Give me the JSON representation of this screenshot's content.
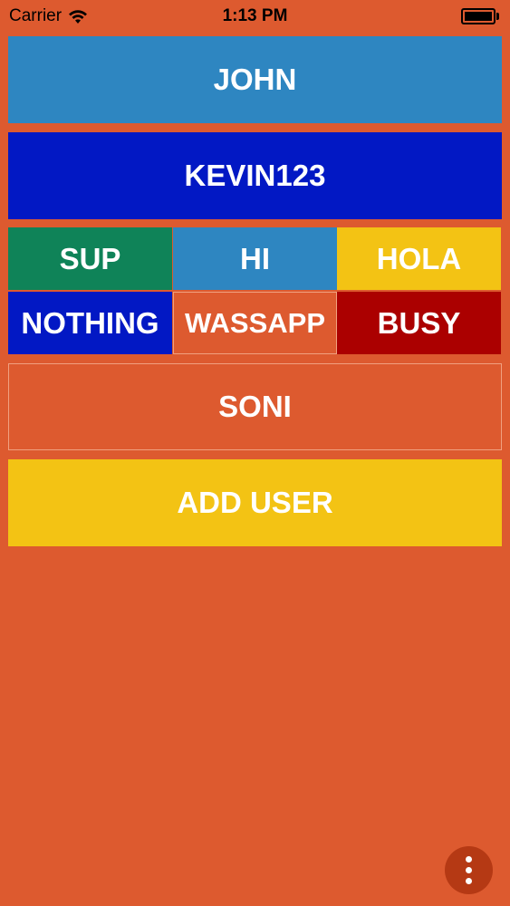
{
  "status_bar": {
    "carrier": "Carrier",
    "time": "1:13 PM",
    "icons": [
      "wifi-icon",
      "battery-icon"
    ]
  },
  "users": {
    "first": "JOHN",
    "second": "KEVIN123",
    "third": "SONI"
  },
  "messages": {
    "row1": [
      "SUP",
      "HI",
      "HOLA"
    ],
    "row2": [
      "NOTHING",
      "WASSAPP",
      "BUSY"
    ]
  },
  "actions": {
    "add_user": "ADD USER",
    "overflow_icon": "more-vertical-icon"
  },
  "colors": {
    "background": "#dd5a2f",
    "blue": "#2e86c1",
    "dark_blue": "#0218c4",
    "green": "#0f8358",
    "yellow": "#f3c314",
    "red": "#ab0000",
    "fab": "#b53914"
  }
}
